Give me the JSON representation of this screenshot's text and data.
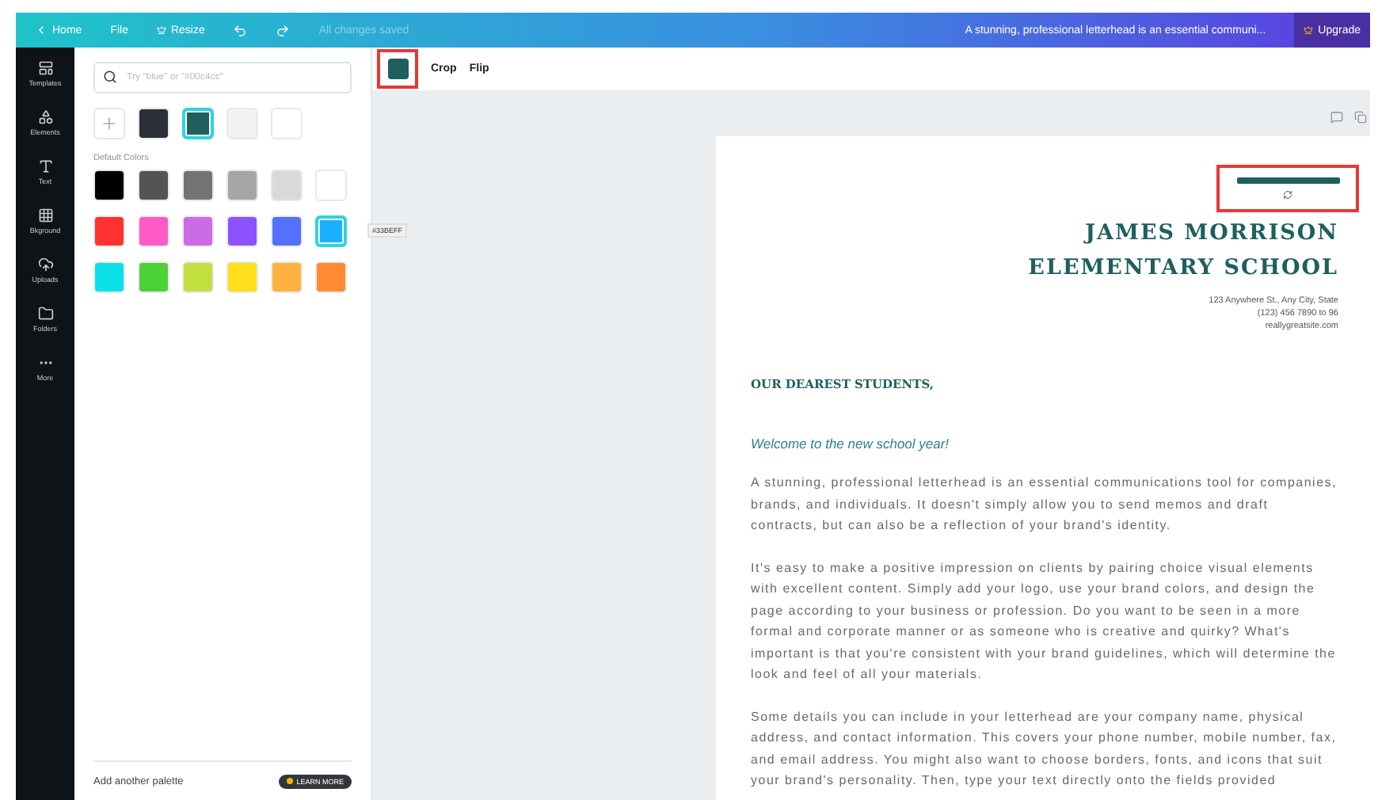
{
  "top_bar": {
    "home": "Home",
    "file": "File",
    "resize": "Resize",
    "save_status": "All changes saved",
    "doc_title": "A stunning, professional letterhead is an essential communi...",
    "upgrade": "Upgrade"
  },
  "sidebar": {
    "items": [
      {
        "kind": "templates",
        "label": "Templates",
        "selected": false
      },
      {
        "kind": "elements",
        "label": "Elements",
        "selected": false
      },
      {
        "kind": "text",
        "label": "Text",
        "selected": false
      },
      {
        "kind": "background",
        "label": "Bkground",
        "selected": false
      },
      {
        "kind": "uploads",
        "label": "Uploads",
        "selected": false
      },
      {
        "kind": "folders",
        "label": "Folders",
        "selected": false
      },
      {
        "kind": "more",
        "label": "More",
        "selected": false
      }
    ]
  },
  "color_panel": {
    "search": {
      "placeholder": "Try \"blue\" or \"#00c4cc\""
    },
    "document_colors": [
      {
        "color": "#2b3038",
        "selected": false
      },
      {
        "color": "#1f5f5f",
        "selected": true
      },
      {
        "color": "#f2f2f2",
        "selected": false
      },
      {
        "color": "#ffffff",
        "selected": false
      }
    ],
    "default_label": "Default Colors",
    "default_colors": [
      {
        "color": "#000000",
        "selected": false
      },
      {
        "color": "#545454",
        "selected": false
      },
      {
        "color": "#737373",
        "selected": false
      },
      {
        "color": "#a6a6a6",
        "selected": false
      },
      {
        "color": "#d9d9d9",
        "selected": false
      },
      {
        "color": "#ffffff",
        "selected": false
      },
      {
        "color": "#ff3131",
        "selected": false
      },
      {
        "color": "#ff5bc8",
        "selected": false
      },
      {
        "color": "#cb6ce6",
        "selected": false
      },
      {
        "color": "#8c52ff",
        "selected": false
      },
      {
        "color": "#5271ff",
        "selected": false
      },
      {
        "color": "#19b0ff",
        "selected": true
      },
      {
        "color": "#0ce0e8",
        "selected": false
      },
      {
        "color": "#4cd137",
        "selected": false
      },
      {
        "color": "#c1e040",
        "selected": false
      },
      {
        "color": "#ffde1a",
        "selected": false
      },
      {
        "color": "#ffb23f",
        "selected": false
      },
      {
        "color": "#ff8a31",
        "selected": false
      }
    ],
    "tooltip": "#33BEFF",
    "footer": {
      "label": "Add another palette",
      "badge": "LEARN MORE"
    }
  },
  "toolbar": {
    "crop": "Crop",
    "flip": "Flip"
  },
  "letter": {
    "school": [
      "JAMES MORRISON",
      "ELEMENTARY SCHOOL"
    ],
    "address": [
      "123 Anywhere St., Any City, State",
      "(123) 456 7890 to 96",
      "reallygreatsite.com"
    ],
    "salutation": "OUR DEAREST STUDENTS,",
    "welcome": "Welcome to the new school year!",
    "paragraphs": [
      "A stunning, professional letterhead is an essential communications tool for companies, brands, and individuals. It doesn't simply allow you to send memos and draft contracts, but can also be a reflection of your brand's identity.",
      "It's easy to make a positive impression on clients by pairing choice visual elements with excellent content. Simply add your logo, use your brand colors, and design the page according to your business or profession. Do you want to be seen in a more formal and corporate manner or as someone who is creative and quirky? What's important is that you're consistent with your brand guidelines, which will determine the look and feel of all your materials.",
      "Some details you can include in your letterhead are your company name, physical address, and contact information. This covers your phone number, mobile number, fax, and email address. You might also want to choose borders, fonts, and icons that suit your brand's personality. Then, type your text directly onto the fields provided"
    ]
  }
}
